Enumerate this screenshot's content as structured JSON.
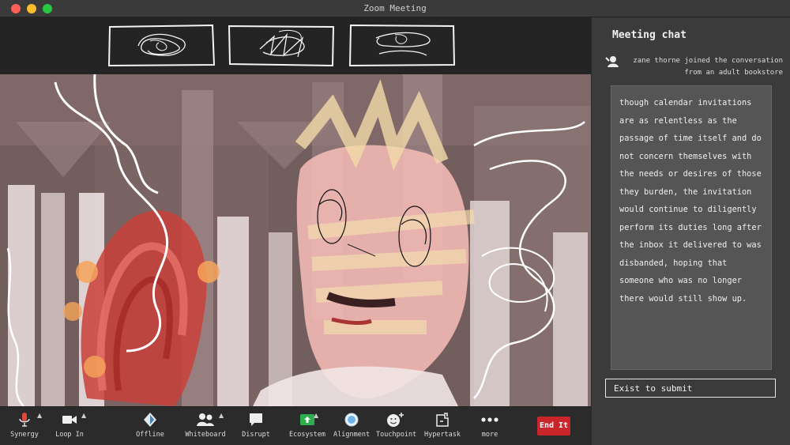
{
  "window": {
    "title": "Zoom Meeting"
  },
  "chat": {
    "header": "Meeting chat",
    "join_line1": "zane thorne  joined the conversation",
    "join_line2": "from an adult bookstore",
    "message": "though calendar invitations are as relentless as the passage of time itself and do not concern themselves with the needs or desires of those they burden, the invitation would continue to diligently perform its duties long after the inbox it delivered to was disbanded, hoping that someone who was no longer there would still show up.",
    "input_placeholder": "Exist to submit"
  },
  "toolbar": {
    "items": [
      {
        "label": "Synergy",
        "icon": "microphone-icon"
      },
      {
        "label": "Loop In",
        "icon": "video-camera-icon"
      },
      {
        "label": "Offline",
        "icon": "shield-icon"
      },
      {
        "label": "Whiteboard",
        "icon": "participants-icon"
      },
      {
        "label": "Disrupt",
        "icon": "chat-bubble-icon"
      },
      {
        "label": "Ecosystem",
        "icon": "share-screen-icon"
      },
      {
        "label": "Alignment",
        "icon": "record-icon"
      },
      {
        "label": "Touchpoint",
        "icon": "reactions-icon"
      },
      {
        "label": "Hypertask",
        "icon": "apps-icon"
      },
      {
        "label": "more",
        "icon": "more-icon"
      }
    ],
    "end_label": "End It"
  },
  "colors": {
    "end_button": "#c8262b",
    "share_green": "#2fae4f",
    "mic_red": "#e0463a"
  }
}
